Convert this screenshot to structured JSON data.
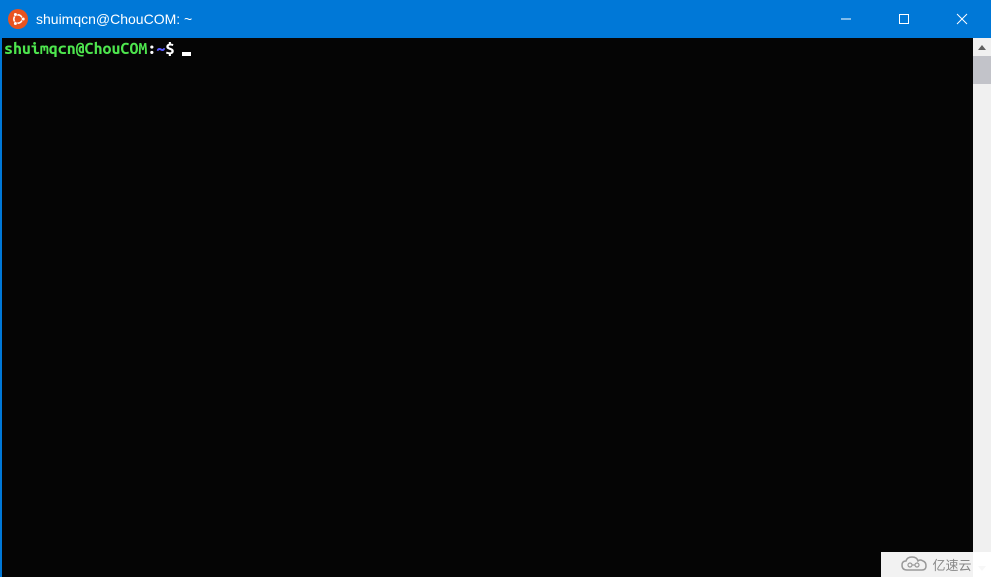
{
  "window": {
    "title": "shuimqcn@ChouCOM: ~"
  },
  "terminal": {
    "prompt": {
      "user_host": "shuimqcn@ChouCOM",
      "separator": ":",
      "path": "~",
      "symbol": "$"
    },
    "input": ""
  },
  "watermark": {
    "text": "亿速云"
  },
  "colors": {
    "titlebar": "#0078d7",
    "terminal_bg": "#050505",
    "prompt_user": "#4ee64e",
    "prompt_path": "#5c5cff",
    "prompt_text": "#ffffff"
  }
}
